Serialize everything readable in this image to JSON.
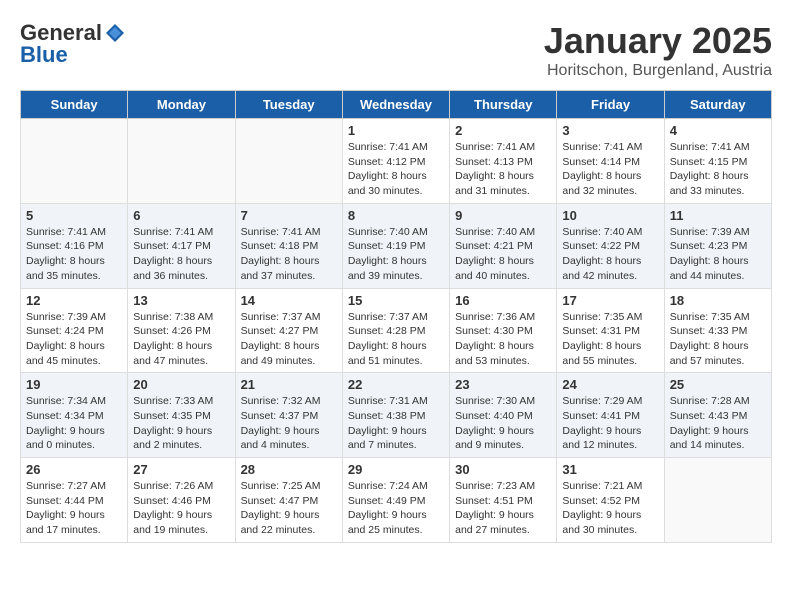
{
  "logo": {
    "general": "General",
    "blue": "Blue"
  },
  "title": "January 2025",
  "subtitle": "Horitschon, Burgenland, Austria",
  "headers": [
    "Sunday",
    "Monday",
    "Tuesday",
    "Wednesday",
    "Thursday",
    "Friday",
    "Saturday"
  ],
  "weeks": [
    [
      {
        "day": "",
        "info": ""
      },
      {
        "day": "",
        "info": ""
      },
      {
        "day": "",
        "info": ""
      },
      {
        "day": "1",
        "info": "Sunrise: 7:41 AM\nSunset: 4:12 PM\nDaylight: 8 hours\nand 30 minutes."
      },
      {
        "day": "2",
        "info": "Sunrise: 7:41 AM\nSunset: 4:13 PM\nDaylight: 8 hours\nand 31 minutes."
      },
      {
        "day": "3",
        "info": "Sunrise: 7:41 AM\nSunset: 4:14 PM\nDaylight: 8 hours\nand 32 minutes."
      },
      {
        "day": "4",
        "info": "Sunrise: 7:41 AM\nSunset: 4:15 PM\nDaylight: 8 hours\nand 33 minutes."
      }
    ],
    [
      {
        "day": "5",
        "info": "Sunrise: 7:41 AM\nSunset: 4:16 PM\nDaylight: 8 hours\nand 35 minutes."
      },
      {
        "day": "6",
        "info": "Sunrise: 7:41 AM\nSunset: 4:17 PM\nDaylight: 8 hours\nand 36 minutes."
      },
      {
        "day": "7",
        "info": "Sunrise: 7:41 AM\nSunset: 4:18 PM\nDaylight: 8 hours\nand 37 minutes."
      },
      {
        "day": "8",
        "info": "Sunrise: 7:40 AM\nSunset: 4:19 PM\nDaylight: 8 hours\nand 39 minutes."
      },
      {
        "day": "9",
        "info": "Sunrise: 7:40 AM\nSunset: 4:21 PM\nDaylight: 8 hours\nand 40 minutes."
      },
      {
        "day": "10",
        "info": "Sunrise: 7:40 AM\nSunset: 4:22 PM\nDaylight: 8 hours\nand 42 minutes."
      },
      {
        "day": "11",
        "info": "Sunrise: 7:39 AM\nSunset: 4:23 PM\nDaylight: 8 hours\nand 44 minutes."
      }
    ],
    [
      {
        "day": "12",
        "info": "Sunrise: 7:39 AM\nSunset: 4:24 PM\nDaylight: 8 hours\nand 45 minutes."
      },
      {
        "day": "13",
        "info": "Sunrise: 7:38 AM\nSunset: 4:26 PM\nDaylight: 8 hours\nand 47 minutes."
      },
      {
        "day": "14",
        "info": "Sunrise: 7:37 AM\nSunset: 4:27 PM\nDaylight: 8 hours\nand 49 minutes."
      },
      {
        "day": "15",
        "info": "Sunrise: 7:37 AM\nSunset: 4:28 PM\nDaylight: 8 hours\nand 51 minutes."
      },
      {
        "day": "16",
        "info": "Sunrise: 7:36 AM\nSunset: 4:30 PM\nDaylight: 8 hours\nand 53 minutes."
      },
      {
        "day": "17",
        "info": "Sunrise: 7:35 AM\nSunset: 4:31 PM\nDaylight: 8 hours\nand 55 minutes."
      },
      {
        "day": "18",
        "info": "Sunrise: 7:35 AM\nSunset: 4:33 PM\nDaylight: 8 hours\nand 57 minutes."
      }
    ],
    [
      {
        "day": "19",
        "info": "Sunrise: 7:34 AM\nSunset: 4:34 PM\nDaylight: 9 hours\nand 0 minutes."
      },
      {
        "day": "20",
        "info": "Sunrise: 7:33 AM\nSunset: 4:35 PM\nDaylight: 9 hours\nand 2 minutes."
      },
      {
        "day": "21",
        "info": "Sunrise: 7:32 AM\nSunset: 4:37 PM\nDaylight: 9 hours\nand 4 minutes."
      },
      {
        "day": "22",
        "info": "Sunrise: 7:31 AM\nSunset: 4:38 PM\nDaylight: 9 hours\nand 7 minutes."
      },
      {
        "day": "23",
        "info": "Sunrise: 7:30 AM\nSunset: 4:40 PM\nDaylight: 9 hours\nand 9 minutes."
      },
      {
        "day": "24",
        "info": "Sunrise: 7:29 AM\nSunset: 4:41 PM\nDaylight: 9 hours\nand 12 minutes."
      },
      {
        "day": "25",
        "info": "Sunrise: 7:28 AM\nSunset: 4:43 PM\nDaylight: 9 hours\nand 14 minutes."
      }
    ],
    [
      {
        "day": "26",
        "info": "Sunrise: 7:27 AM\nSunset: 4:44 PM\nDaylight: 9 hours\nand 17 minutes."
      },
      {
        "day": "27",
        "info": "Sunrise: 7:26 AM\nSunset: 4:46 PM\nDaylight: 9 hours\nand 19 minutes."
      },
      {
        "day": "28",
        "info": "Sunrise: 7:25 AM\nSunset: 4:47 PM\nDaylight: 9 hours\nand 22 minutes."
      },
      {
        "day": "29",
        "info": "Sunrise: 7:24 AM\nSunset: 4:49 PM\nDaylight: 9 hours\nand 25 minutes."
      },
      {
        "day": "30",
        "info": "Sunrise: 7:23 AM\nSunset: 4:51 PM\nDaylight: 9 hours\nand 27 minutes."
      },
      {
        "day": "31",
        "info": "Sunrise: 7:21 AM\nSunset: 4:52 PM\nDaylight: 9 hours\nand 30 minutes."
      },
      {
        "day": "",
        "info": ""
      }
    ]
  ]
}
